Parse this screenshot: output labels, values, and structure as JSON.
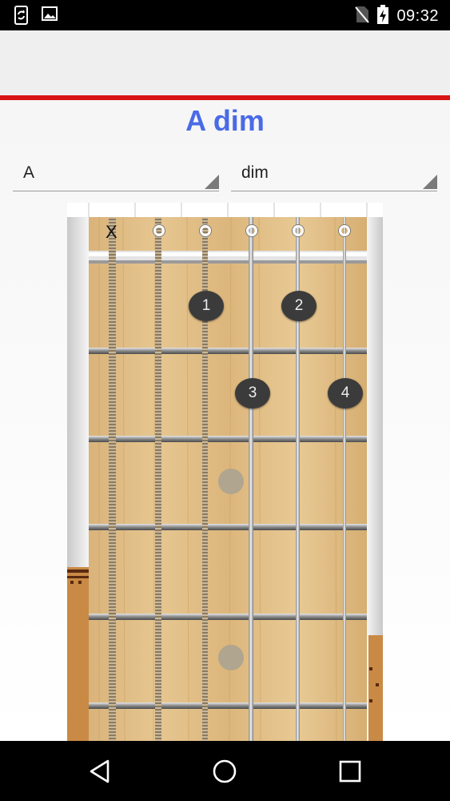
{
  "status_bar": {
    "time": "09:32",
    "left_icons": [
      "sync-icon",
      "image-icon"
    ],
    "right_icons": [
      "no-sim-icon",
      "battery-charging-icon"
    ]
  },
  "chord": {
    "title": "A dim",
    "root": "A",
    "type": "dim"
  },
  "fretboard": {
    "open_markers": [
      "X",
      "O",
      "O",
      "O",
      "O",
      "O"
    ],
    "fingers": [
      {
        "label": "1",
        "string": 3,
        "fret": 1
      },
      {
        "label": "2",
        "string": 5,
        "fret": 1
      },
      {
        "label": "3",
        "string": 4,
        "fret": 2
      },
      {
        "label": "4",
        "string": 6,
        "fret": 2
      }
    ],
    "inlay_frets": [
      3,
      5
    ]
  },
  "navbar": {
    "icons": [
      "back-icon",
      "home-icon",
      "recents-icon"
    ]
  },
  "colors": {
    "accent_red": "#d81414",
    "title_blue": "#4a6be6"
  }
}
